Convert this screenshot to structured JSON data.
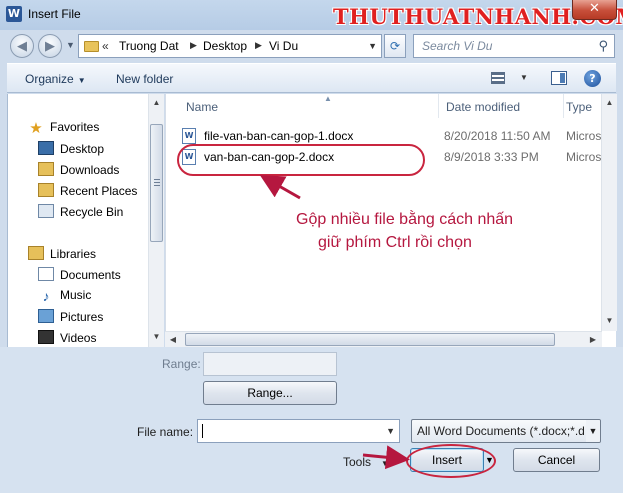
{
  "window": {
    "title": "Insert File",
    "app_icon_letter": "W",
    "close_symbol": "✕",
    "watermark": "THUTHUATNHANH.COM"
  },
  "address": {
    "back_symbol": "◀",
    "forward_symbol": "▶",
    "overflow": "«",
    "crumbs": [
      "Truong Dat",
      "Desktop",
      "Vi Du"
    ],
    "separator": "▶",
    "refresh_symbol": "⟳",
    "search_placeholder": "Search Vi Du",
    "search_symbol": "⚲"
  },
  "toolbar": {
    "organize": "Organize",
    "new_folder": "New folder",
    "help_symbol": "?"
  },
  "nav": {
    "favorites": "Favorites",
    "favorites_items": [
      "Desktop",
      "Downloads",
      "Recent Places",
      "Recycle Bin"
    ],
    "libraries": "Libraries",
    "libraries_items": [
      "Documents",
      "Music",
      "Pictures",
      "Videos"
    ]
  },
  "columns": {
    "name": "Name",
    "date_modified": "Date modified",
    "type": "Type"
  },
  "files": [
    {
      "name": "file-van-ban-can-gop-1.docx",
      "date": "8/20/2018 11:50 AM",
      "type": "Microsoft"
    },
    {
      "name": "van-ban-can-gop-2.docx",
      "date": "8/9/2018 3:33 PM",
      "type": "Microsoft"
    }
  ],
  "annotation": {
    "line1": "Gộp nhiều file bằng cách nhấn",
    "line2": "giữ phím Ctrl rồi chọn"
  },
  "bottom": {
    "range_label": "Range:",
    "range_button": "Range...",
    "file_name_label": "File name:",
    "file_name_value": "",
    "filter": "All Word Documents (*.docx;*.d",
    "tools": "Tools",
    "insert": "Insert",
    "cancel": "Cancel"
  },
  "colors": {
    "annotation": "#b5173f",
    "watermark": "#e02020",
    "close_button": "#c74f3a"
  }
}
